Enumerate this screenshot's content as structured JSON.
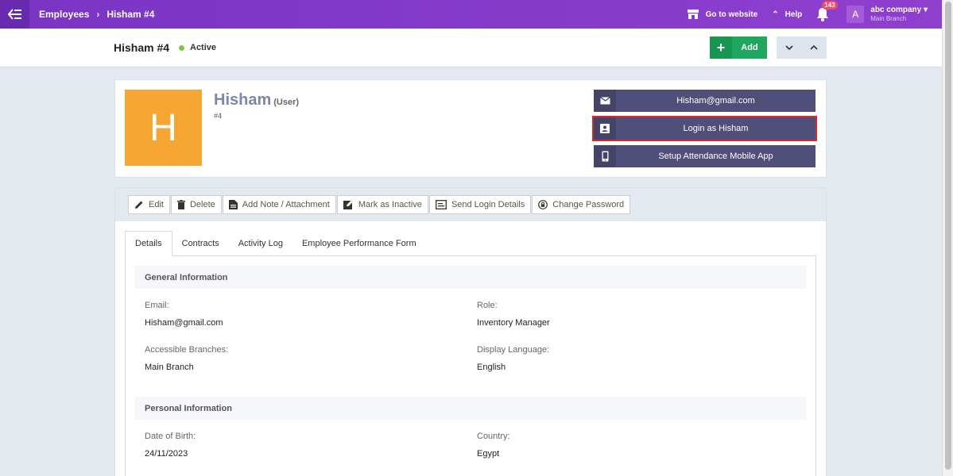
{
  "topbar": {
    "breadcrumb": [
      "Employees",
      "Hisham #4"
    ],
    "go_to_website": "Go to website",
    "help": "Help",
    "notifications_count": "143",
    "company_initial": "A",
    "company_name": "abc company",
    "company_branch": "Main Branch"
  },
  "header": {
    "title": "Hisham #4",
    "status": "Active",
    "add_label": "Add"
  },
  "profile": {
    "initial": "H",
    "name": "Hisham",
    "role": "(User)",
    "id": "#4",
    "actions": [
      {
        "label": "Hisham@gmail.com",
        "icon": "mail-icon"
      },
      {
        "label": "Login as Hisham",
        "icon": "user-card-icon"
      },
      {
        "label": "Setup Attendance Mobile App",
        "icon": "mobile-icon"
      }
    ]
  },
  "toolbar": {
    "edit": "Edit",
    "delete": "Delete",
    "add_note": "Add Note / Attachment",
    "mark_inactive": "Mark as Inactive",
    "send_login": "Send Login Details",
    "change_password": "Change Password"
  },
  "tabs": [
    "Details",
    "Contracts",
    "Activity Log",
    "Employee Performance Form"
  ],
  "details": {
    "general_title": "General Information",
    "email_label": "Email:",
    "email_value": "Hisham@gmail.com",
    "role_label": "Role:",
    "role_value": "Inventory Manager",
    "branches_label": "Accessible Branches:",
    "branches_value": "Main Branch",
    "language_label": "Display Language:",
    "language_value": "English",
    "personal_title": "Personal Information",
    "dob_label": "Date of Birth:",
    "dob_value": "24/11/2023",
    "country_label": "Country:",
    "country_value": "Egypt"
  },
  "colors": {
    "topbar": "#8a3dcc",
    "add_button": "#1fa65f",
    "action_button": "#4f4f7a",
    "avatar": "#f5a633",
    "highlight": "#d9272e"
  }
}
